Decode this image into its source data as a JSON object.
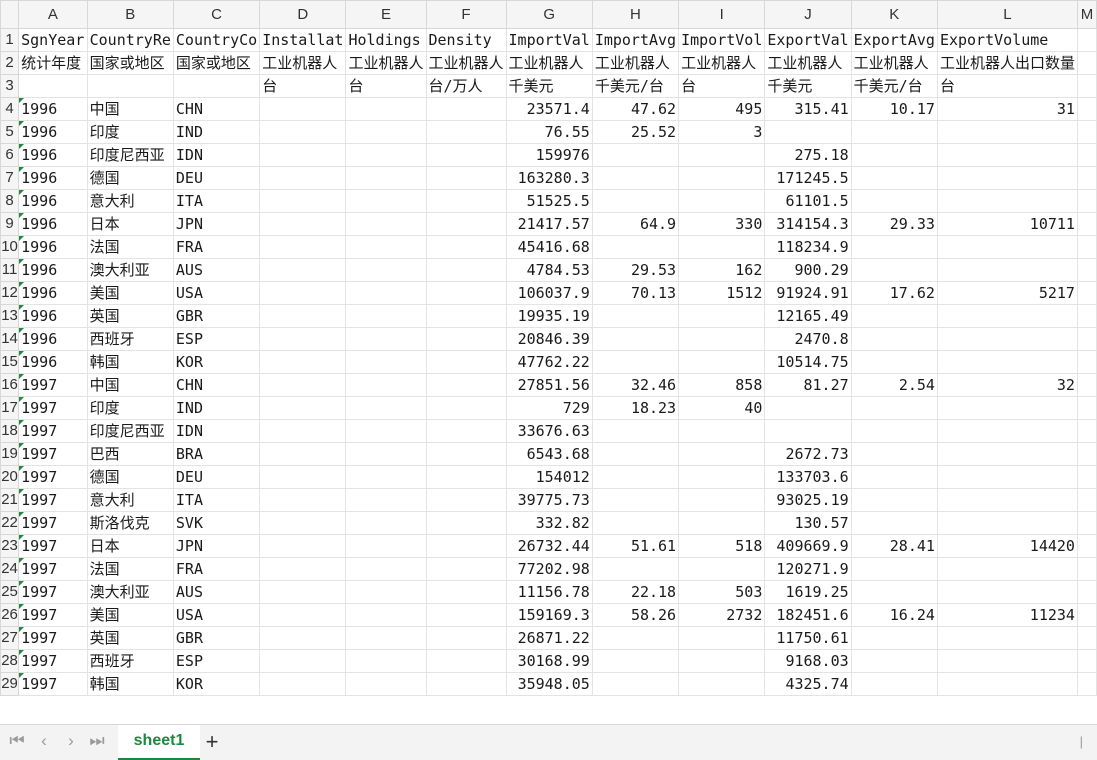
{
  "column_headers": [
    "A",
    "B",
    "C",
    "D",
    "E",
    "F",
    "G",
    "H",
    "I",
    "J",
    "K",
    "L",
    "M"
  ],
  "row_numbers": [
    1,
    2,
    3,
    4,
    5,
    6,
    7,
    8,
    9,
    10,
    11,
    12,
    13,
    14,
    15,
    16,
    17,
    18,
    19,
    20,
    21,
    22,
    23,
    24,
    25,
    26,
    27,
    28,
    29
  ],
  "rows": [
    [
      "SgnYear",
      "CountryRe",
      "CountryCo",
      "Installat",
      "Holdings",
      "Density",
      "ImportVal",
      "ImportAvg",
      "ImportVol",
      "ExportVal",
      "ExportAvg",
      "ExportVolume",
      ""
    ],
    [
      "统计年度",
      "国家或地区",
      "国家或地区",
      "工业机器人",
      "工业机器人",
      "工业机器人",
      "工业机器人",
      "工业机器人",
      "工业机器人",
      "工业机器人",
      "工业机器人",
      "工业机器人出口数量",
      ""
    ],
    [
      "",
      "",
      "",
      "台",
      "台",
      "台/万人",
      "千美元",
      "千美元/台",
      "台",
      "千美元",
      "千美元/台",
      "台",
      ""
    ],
    [
      "1996",
      "中国",
      "CHN",
      "",
      "",
      "",
      "23571.4",
      "47.62",
      "495",
      "315.41",
      "10.17",
      "31",
      ""
    ],
    [
      "1996",
      "印度",
      "IND",
      "",
      "",
      "",
      "76.55",
      "25.52",
      "3",
      "",
      "",
      "",
      ""
    ],
    [
      "1996",
      "印度尼西亚",
      "IDN",
      "",
      "",
      "",
      "159976",
      "",
      "",
      "275.18",
      "",
      "",
      ""
    ],
    [
      "1996",
      "德国",
      "DEU",
      "",
      "",
      "",
      "163280.3",
      "",
      "",
      "171245.5",
      "",
      "",
      ""
    ],
    [
      "1996",
      "意大利",
      "ITA",
      "",
      "",
      "",
      "51525.5",
      "",
      "",
      "61101.5",
      "",
      "",
      ""
    ],
    [
      "1996",
      "日本",
      "JPN",
      "",
      "",
      "",
      "21417.57",
      "64.9",
      "330",
      "314154.3",
      "29.33",
      "10711",
      ""
    ],
    [
      "1996",
      "法国",
      "FRA",
      "",
      "",
      "",
      "45416.68",
      "",
      "",
      "118234.9",
      "",
      "",
      ""
    ],
    [
      "1996",
      "澳大利亚",
      "AUS",
      "",
      "",
      "",
      "4784.53",
      "29.53",
      "162",
      "900.29",
      "",
      "",
      ""
    ],
    [
      "1996",
      "美国",
      "USA",
      "",
      "",
      "",
      "106037.9",
      "70.13",
      "1512",
      "91924.91",
      "17.62",
      "5217",
      ""
    ],
    [
      "1996",
      "英国",
      "GBR",
      "",
      "",
      "",
      "19935.19",
      "",
      "",
      "12165.49",
      "",
      "",
      ""
    ],
    [
      "1996",
      "西班牙",
      "ESP",
      "",
      "",
      "",
      "20846.39",
      "",
      "",
      "2470.8",
      "",
      "",
      ""
    ],
    [
      "1996",
      "韩国",
      "KOR",
      "",
      "",
      "",
      "47762.22",
      "",
      "",
      "10514.75",
      "",
      "",
      ""
    ],
    [
      "1997",
      "中国",
      "CHN",
      "",
      "",
      "",
      "27851.56",
      "32.46",
      "858",
      "81.27",
      "2.54",
      "32",
      ""
    ],
    [
      "1997",
      "印度",
      "IND",
      "",
      "",
      "",
      "729",
      "18.23",
      "40",
      "",
      "",
      "",
      ""
    ],
    [
      "1997",
      "印度尼西亚",
      "IDN",
      "",
      "",
      "",
      "33676.63",
      "",
      "",
      "",
      "",
      "",
      ""
    ],
    [
      "1997",
      "巴西",
      "BRA",
      "",
      "",
      "",
      "6543.68",
      "",
      "",
      "2672.73",
      "",
      "",
      ""
    ],
    [
      "1997",
      "德国",
      "DEU",
      "",
      "",
      "",
      "154012",
      "",
      "",
      "133703.6",
      "",
      "",
      ""
    ],
    [
      "1997",
      "意大利",
      "ITA",
      "",
      "",
      "",
      "39775.73",
      "",
      "",
      "93025.19",
      "",
      "",
      ""
    ],
    [
      "1997",
      "斯洛伐克",
      "SVK",
      "",
      "",
      "",
      "332.82",
      "",
      "",
      "130.57",
      "",
      "",
      ""
    ],
    [
      "1997",
      "日本",
      "JPN",
      "",
      "",
      "",
      "26732.44",
      "51.61",
      "518",
      "409669.9",
      "28.41",
      "14420",
      ""
    ],
    [
      "1997",
      "法国",
      "FRA",
      "",
      "",
      "",
      "77202.98",
      "",
      "",
      "120271.9",
      "",
      "",
      ""
    ],
    [
      "1997",
      "澳大利亚",
      "AUS",
      "",
      "",
      "",
      "11156.78",
      "22.18",
      "503",
      "1619.25",
      "",
      "",
      ""
    ],
    [
      "1997",
      "美国",
      "USA",
      "",
      "",
      "",
      "159169.3",
      "58.26",
      "2732",
      "182451.6",
      "16.24",
      "11234",
      ""
    ],
    [
      "1997",
      "英国",
      "GBR",
      "",
      "",
      "",
      "26871.22",
      "",
      "",
      "11750.61",
      "",
      "",
      ""
    ],
    [
      "1997",
      "西班牙",
      "ESP",
      "",
      "",
      "",
      "30168.99",
      "",
      "",
      "9168.03",
      "",
      "",
      ""
    ],
    [
      "1997",
      "韩国",
      "KOR",
      "",
      "",
      "",
      "35948.05",
      "",
      "",
      "4325.74",
      "",
      "",
      ""
    ]
  ],
  "sheet_tab": "sheet1",
  "add_sheet_label": "+",
  "nav_icons": [
    "first-sheet-icon",
    "prev-sheet-icon",
    "next-sheet-icon",
    "last-sheet-icon"
  ],
  "accent_color": "#1b8a3e"
}
